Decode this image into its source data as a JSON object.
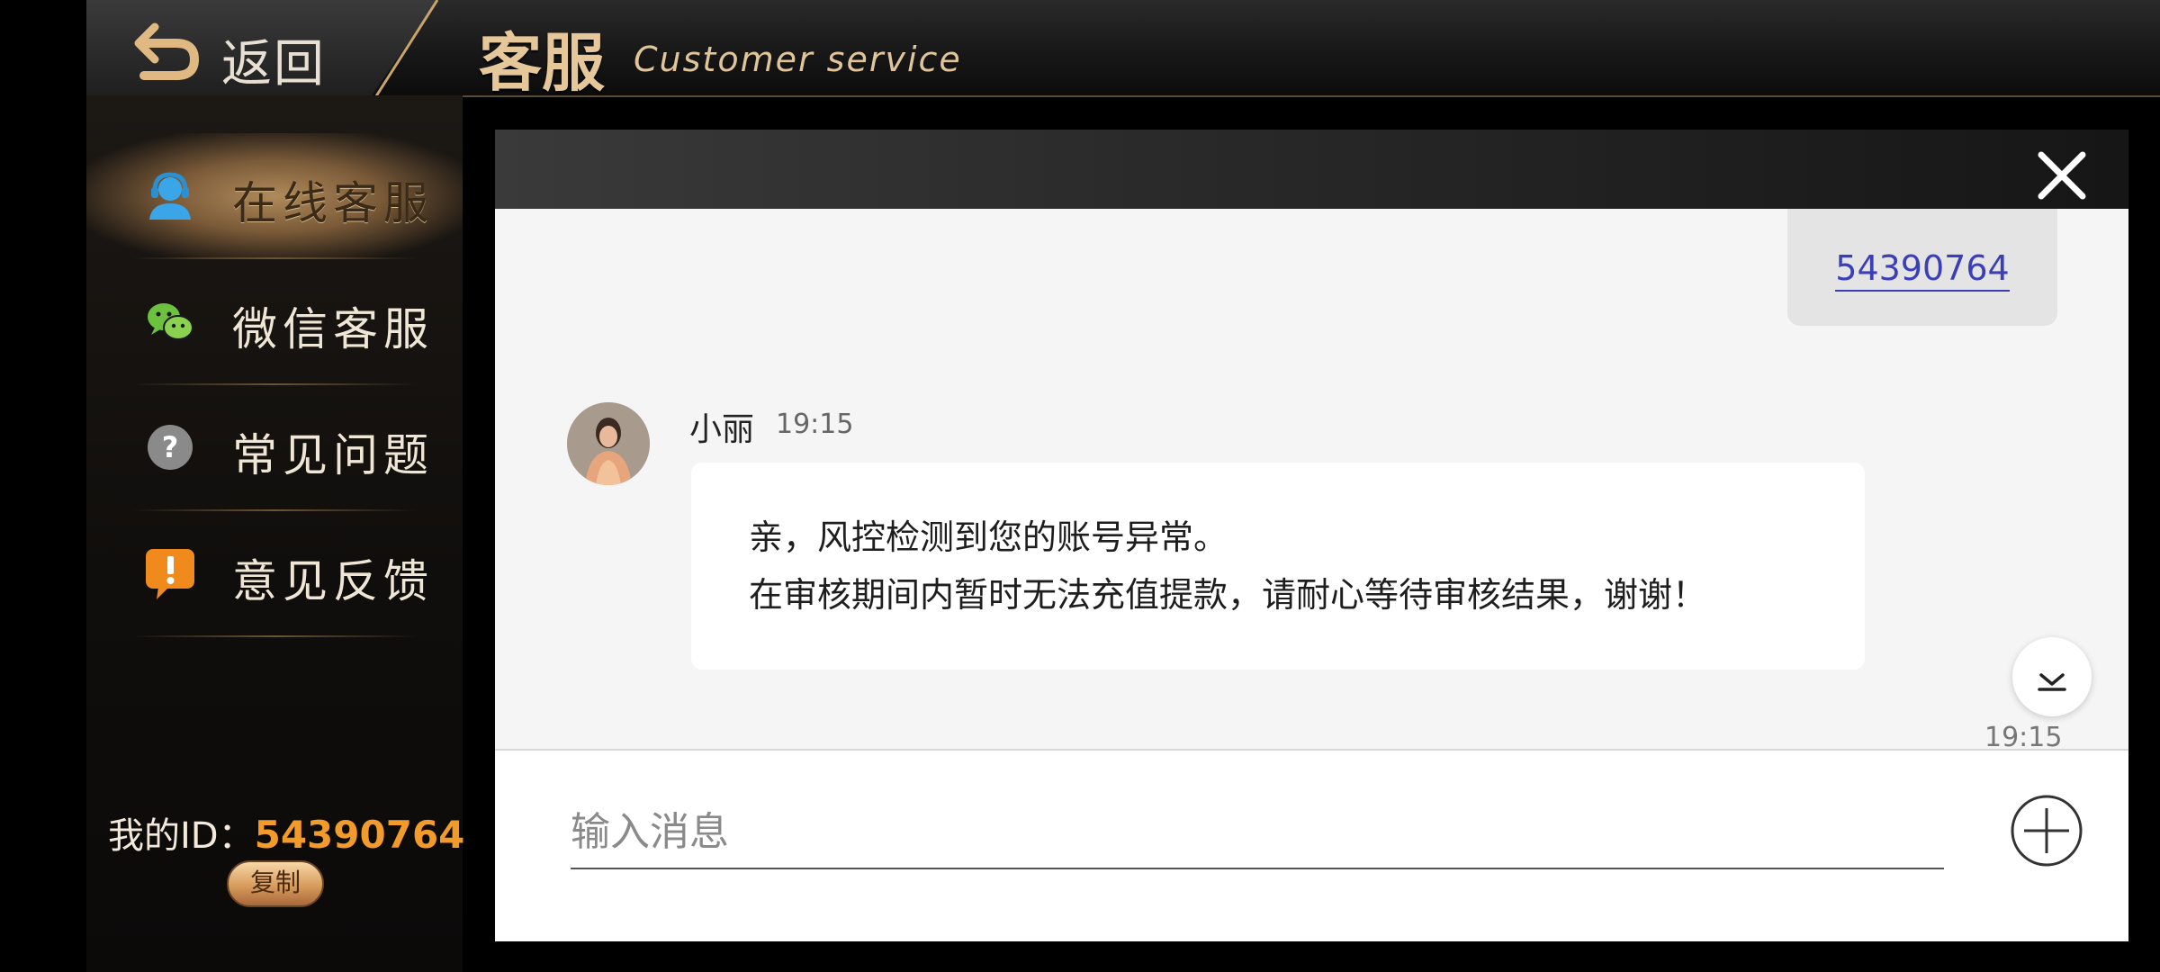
{
  "header": {
    "back_label": "返回",
    "title": "客服",
    "subtitle": "Customer service"
  },
  "sidebar": {
    "items": [
      {
        "label": "在线客服",
        "icon": "headset-agent-icon",
        "active": true
      },
      {
        "label": "微信客服",
        "icon": "wechat-icon",
        "active": false
      },
      {
        "label": "常见问题",
        "icon": "question-icon",
        "active": false
      },
      {
        "label": "意见反馈",
        "icon": "feedback-exclamation-icon",
        "active": false
      }
    ],
    "my_id_label": "我的ID：",
    "my_id_value": "54390764",
    "copy_label": "复制"
  },
  "chat": {
    "own_message": "54390764",
    "agent": {
      "name": "小丽",
      "time": "19:15",
      "lines": [
        "亲，风控检测到您的账号异常。",
        "在审核期间内暂时无法充值提款，请耐心等待审核结果，谢谢！"
      ]
    },
    "bottom_time": "19:15",
    "input_placeholder": "输入消息"
  },
  "colors": {
    "accent_gold": "#e6c79a",
    "id_orange": "#f29a2a",
    "link_blue": "#3a3fb8"
  }
}
